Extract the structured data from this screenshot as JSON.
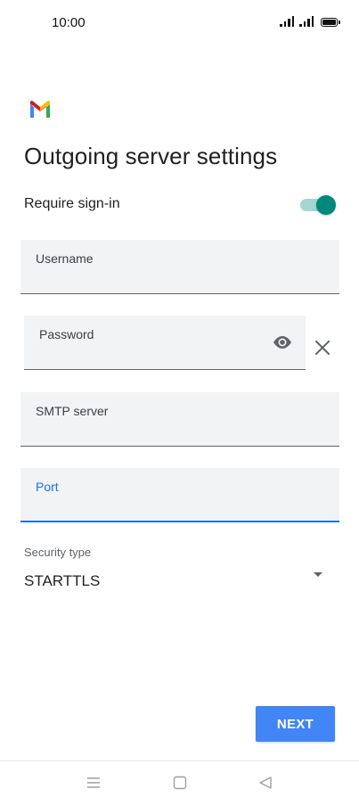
{
  "status_bar": {
    "time": "10:00",
    "icons": [
      "signal-icon",
      "signal-icon",
      "battery-icon"
    ]
  },
  "app": {
    "logo_icon": "gmail-logo-icon"
  },
  "page": {
    "title": "Outgoing server settings"
  },
  "require_signin": {
    "label": "Require sign-in",
    "enabled": true,
    "accent_color": "#00897b"
  },
  "fields": {
    "username": {
      "label": "Username",
      "value": ""
    },
    "password": {
      "label": "Password",
      "value": ""
    },
    "smtp_server": {
      "label": "SMTP server",
      "value": ""
    },
    "port": {
      "label": "Port",
      "value": "",
      "focused": true
    }
  },
  "security": {
    "label": "Security type",
    "selected": "STARTTLS"
  },
  "actions": {
    "next_label": "NEXT",
    "next_color": "#4285f4"
  },
  "nav": {
    "icons": [
      "menu-icon",
      "home-icon",
      "back-icon"
    ]
  }
}
